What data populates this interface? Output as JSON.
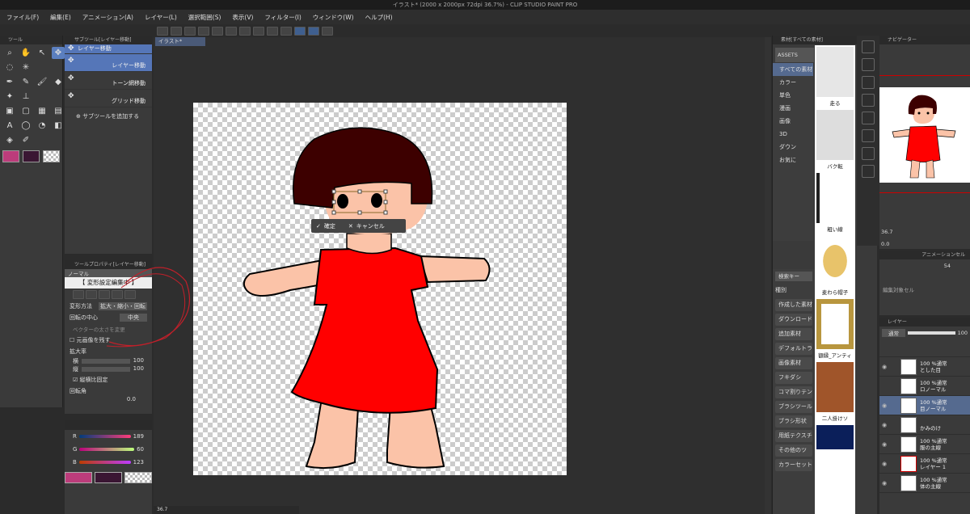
{
  "app": {
    "title": "イラスト* (2000 x 2000px 72dpi 36.7%) - CLIP STUDIO PAINT PRO"
  },
  "menu": [
    "ファイル(F)",
    "編集(E)",
    "アニメーション(A)",
    "レイヤー(L)",
    "選択範囲(S)",
    "表示(V)",
    "フィルター(I)",
    "ウィンドウ(W)",
    "ヘルプ(H)"
  ],
  "tool_panel": {
    "title": "ツール"
  },
  "subtool_panel": {
    "title": "サブツール[レイヤー移動]",
    "group_label": "レイヤー移動",
    "items": [
      "レイヤー移動",
      "トーン網移動",
      "グリッド移動"
    ],
    "add_label": "サブツールを追加する"
  },
  "tool_property": {
    "title": "ツールプロパティ[レイヤー移動]",
    "mode": "ノーマル",
    "status": "【 変形設定編集中 】",
    "transform_method_label": "変形方法",
    "transform_method_value": "拡大・縮小・回転",
    "rotation_center_label": "回転の中心",
    "rotation_center_value": "中央",
    "vector_width_label": "ベクターの太さを変更",
    "keep_original_label": "元画像を残す",
    "scale_label": "拡大率",
    "width_label": "横",
    "width_value": "100",
    "height_label": "縦",
    "height_value": "100",
    "keep_ratio_label": "縦横比固定",
    "rotation_label": "回転角",
    "rotation_value": "0.0"
  },
  "color_panel": {
    "r_label": "R",
    "r_value": "189",
    "g_label": "G",
    "g_value": "60",
    "b_label": "B",
    "b_value": "123",
    "main_color": "#bc3c7b",
    "sub_color": "#3a1633"
  },
  "document": {
    "tab": "イラスト*",
    "zoom": "36.7"
  },
  "transform_bar": {
    "confirm": "確定",
    "cancel": "キャンセル"
  },
  "material_panel": {
    "title": "素材[すべての素材]",
    "assets_label": "ASSETS",
    "tree": [
      "すべての素材",
      "カラー",
      "単色",
      "漫画",
      "画像",
      "3D",
      "ダウン",
      "お気に"
    ],
    "thumbs": [
      "走る",
      "バク転",
      "粗い線",
      "麦わら帽子",
      "額縁_アンティ",
      "二人掛けソ",
      ""
    ],
    "search_placeholder": "検索キー",
    "kind_label": "種別",
    "categories": [
      "作成した素材",
      "ダウンロード",
      "追加素材",
      "デフォルトラ",
      "画像素材",
      "フキダシ",
      "コマ割りテン",
      "ブラシツール",
      "ブラシ形状",
      "用紙テクスチ",
      "その他のツ",
      "カラーセット"
    ]
  },
  "navigator": {
    "title": "ナビゲーター",
    "zoom": "36.7",
    "angle": "0.0"
  },
  "animation": {
    "title": "アニメーションセル",
    "frame": "54",
    "edit_label": "編集対象セル"
  },
  "layer_panel": {
    "title": "レイヤー",
    "blend": "通常",
    "opacity": "100",
    "layers": [
      {
        "opacity": "100 %通常",
        "name": "とした目"
      },
      {
        "opacity": "100 %通常",
        "name": "ロノーマル"
      },
      {
        "opacity": "100 %通常",
        "name": "目ノーマル"
      },
      {
        "opacity": "",
        "name": "かみのけ"
      },
      {
        "opacity": "100 %通常",
        "name": "服の主線"
      },
      {
        "opacity": "100 %通常",
        "name": "レイヤー 1"
      },
      {
        "opacity": "100 %通常",
        "name": "体の主線"
      }
    ]
  }
}
